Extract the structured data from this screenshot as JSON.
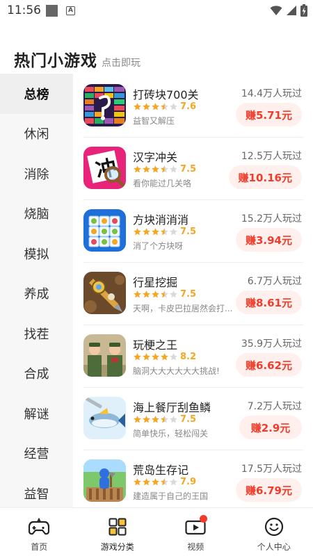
{
  "status_bar": {
    "time": "11:56"
  },
  "header": {
    "title": "热门小游戏",
    "subtitle": "点击即玩"
  },
  "sidebar": {
    "items": [
      {
        "label": "总榜",
        "active": true
      },
      {
        "label": "休闲"
      },
      {
        "label": "消除"
      },
      {
        "label": "烧脑"
      },
      {
        "label": "模拟"
      },
      {
        "label": "养成"
      },
      {
        "label": "找茬"
      },
      {
        "label": "合成"
      },
      {
        "label": "解谜"
      },
      {
        "label": "经营"
      },
      {
        "label": "益智"
      }
    ]
  },
  "games": [
    {
      "name": "打砖块700关",
      "rating": "7.6",
      "stars": 3.5,
      "desc": "益智又解压",
      "players": "14.4万人玩过",
      "reward": "赚5.71元",
      "icon": "brick-breaker-icon"
    },
    {
      "name": "汉字冲关",
      "rating": "7.5",
      "stars": 3.5,
      "desc": "看你能过几关咯",
      "players": "12.5万人玩过",
      "reward": "赚10.16元",
      "icon": "chinese-character-icon"
    },
    {
      "name": "方块消消消",
      "rating": "7.5",
      "stars": 3.5,
      "desc": "消了个方块呀",
      "players": "15.2万人玩过",
      "reward": "赚3.94元",
      "icon": "block-match-icon"
    },
    {
      "name": "行星挖掘",
      "rating": "7.5",
      "stars": 3.5,
      "desc": "天啊，卡皮巴拉居然会打...",
      "players": "6.7万人玩过",
      "reward": "赚8.61元",
      "icon": "planet-drill-icon"
    },
    {
      "name": "玩梗之王",
      "rating": "8.2",
      "stars": 4,
      "desc": "脑洞大大大大大大挑战!",
      "players": "35.9万人玩过",
      "reward": "赚6.62元",
      "icon": "meme-king-icon"
    },
    {
      "name": "海上餐厅刮鱼鳞",
      "rating": "7.5",
      "stars": 3.5,
      "desc": "简单快乐，轻松闯关",
      "players": "7.2万人玩过",
      "reward": "赚2.9元",
      "icon": "fish-scale-icon"
    },
    {
      "name": "荒岛生存记",
      "rating": "7.9",
      "stars": 3.5,
      "desc": "建造属于自己的王国",
      "players": "17.5万人玩过",
      "reward": "赚6.79元",
      "icon": "island-survival-icon"
    }
  ],
  "bottom_nav": [
    {
      "label": "首页",
      "icon": "gamepad-icon"
    },
    {
      "label": "游戏分类",
      "icon": "grid-icon",
      "active": true
    },
    {
      "label": "视频",
      "icon": "video-icon",
      "badge": true
    },
    {
      "label": "个人中心",
      "icon": "smiley-icon"
    }
  ],
  "colors": {
    "accent": "#f33b2a",
    "star": "#f5a623",
    "reward_bg": "#fff0ed"
  }
}
